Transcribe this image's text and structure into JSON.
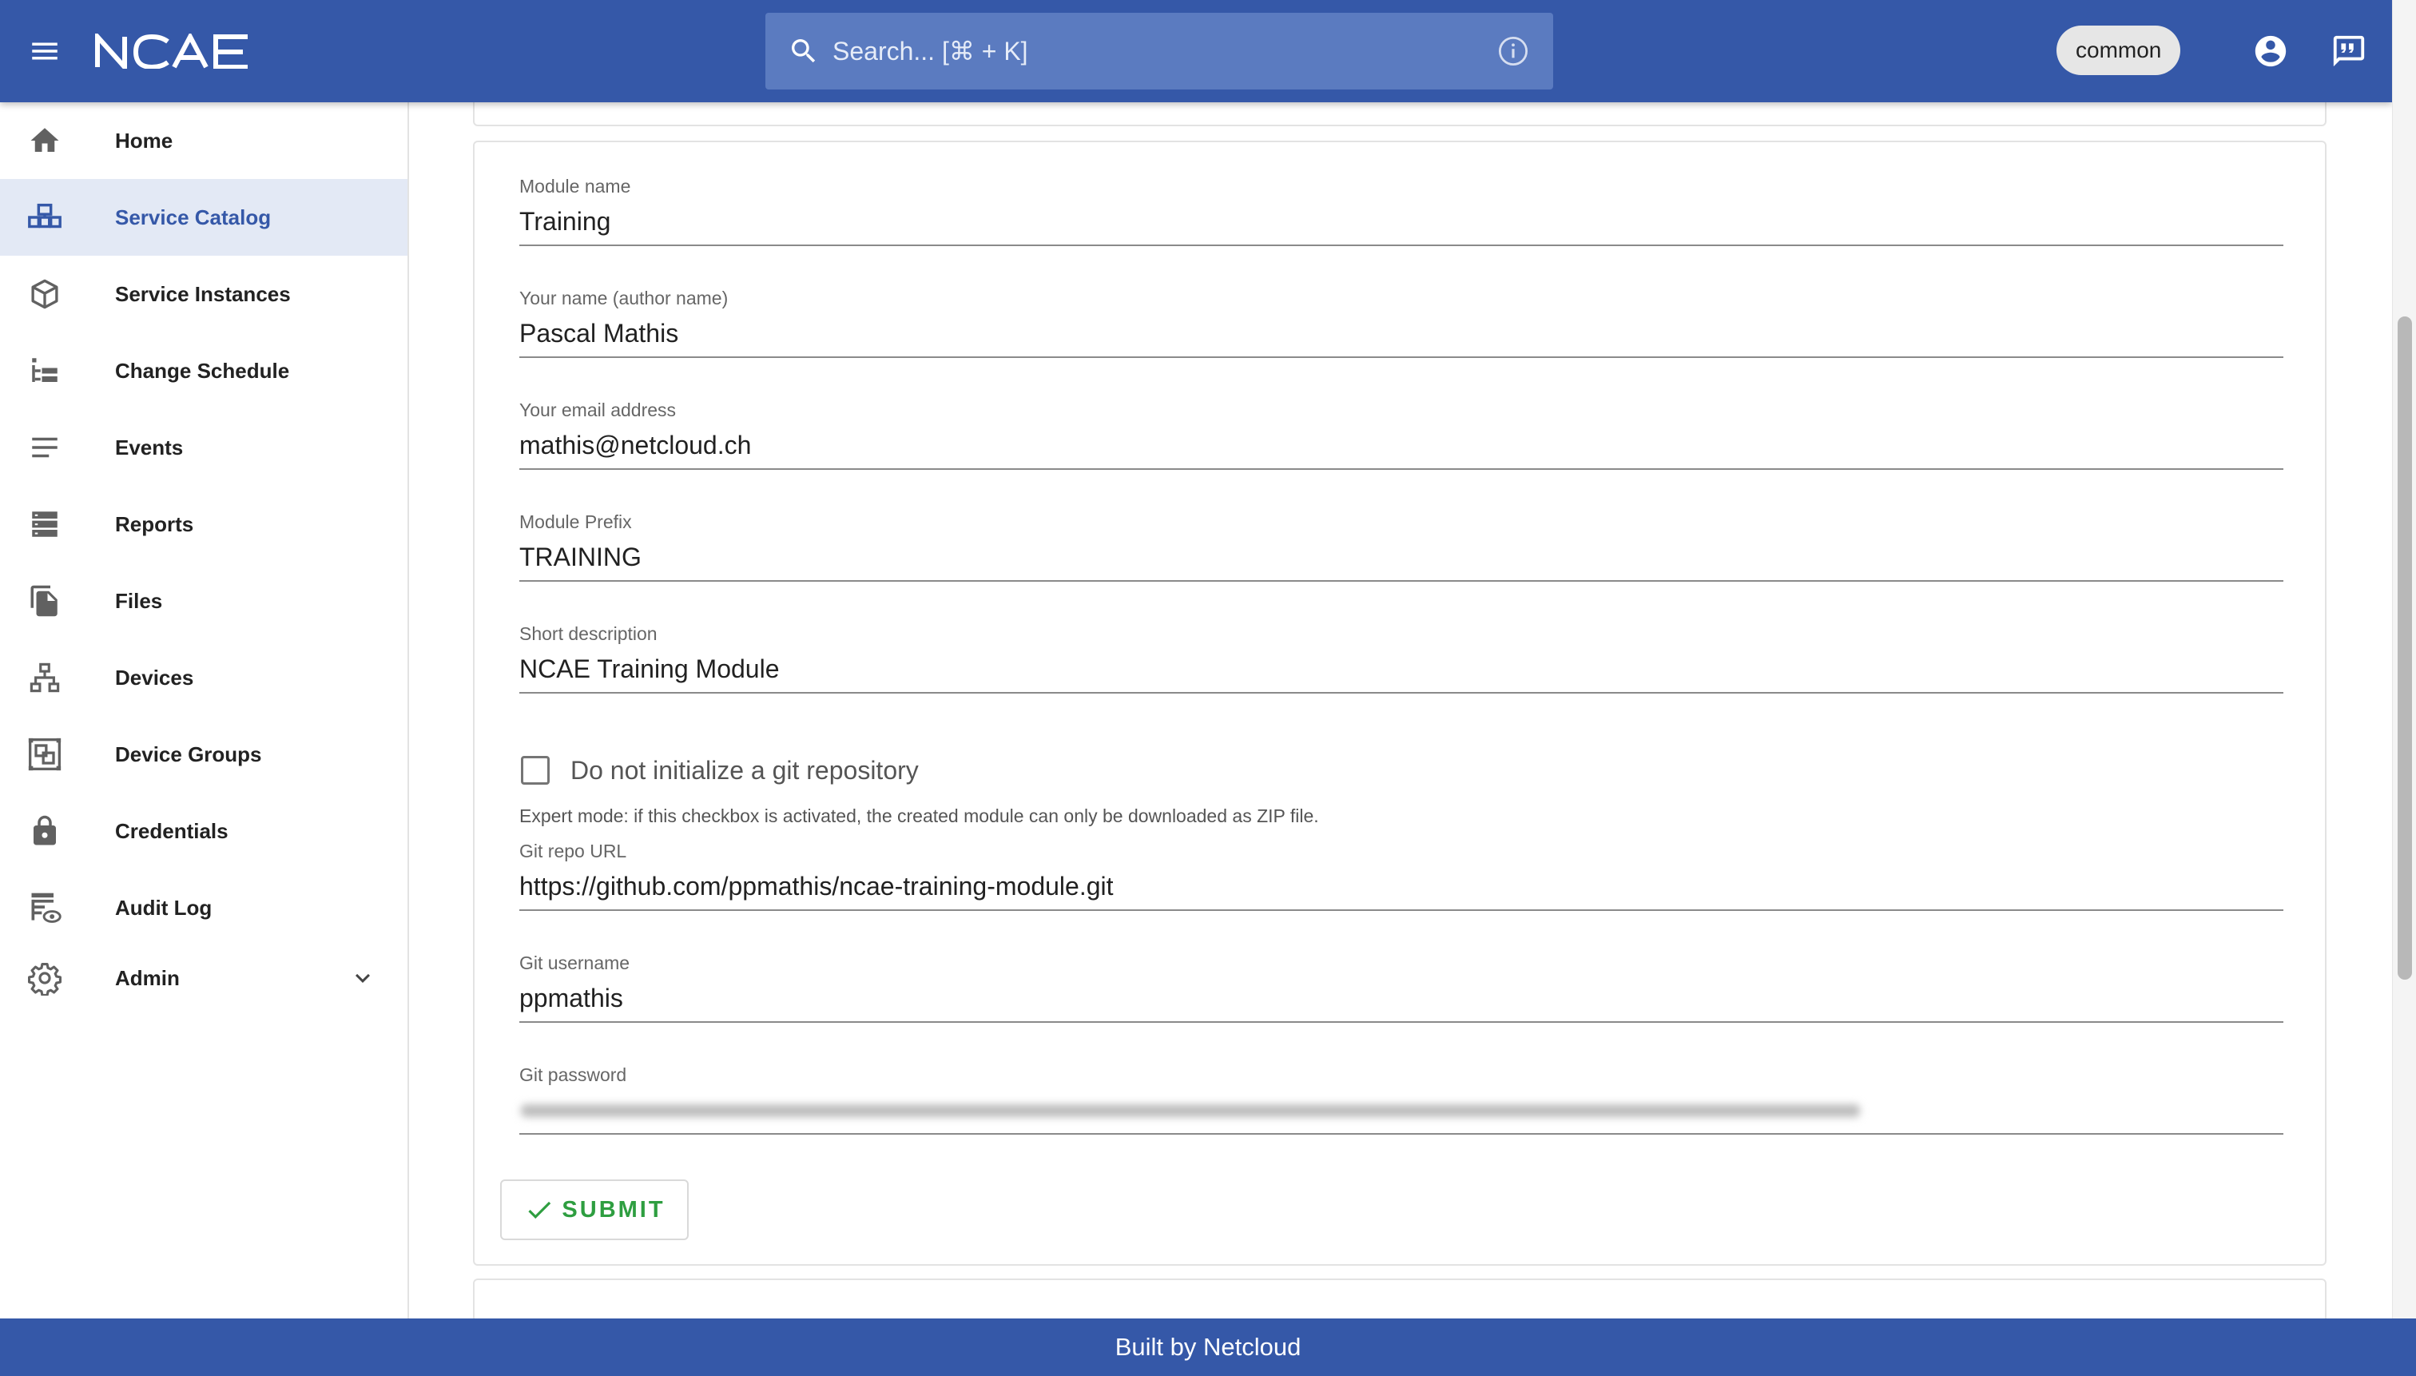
{
  "header": {
    "logo_text": "NCAE",
    "search_placeholder": "Search... [⌘ + K]",
    "namespace_chip": "common"
  },
  "sidebar": {
    "items": [
      {
        "label": "Home",
        "icon": "home-icon"
      },
      {
        "label": "Service Catalog",
        "icon": "service-catalog-icon",
        "active": true
      },
      {
        "label": "Service Instances",
        "icon": "cube-icon"
      },
      {
        "label": "Change Schedule",
        "icon": "schedule-tree-icon"
      },
      {
        "label": "Events",
        "icon": "events-lines-icon"
      },
      {
        "label": "Reports",
        "icon": "reports-icon"
      },
      {
        "label": "Files",
        "icon": "files-icon"
      },
      {
        "label": "Devices",
        "icon": "network-icon"
      },
      {
        "label": "Device Groups",
        "icon": "device-groups-icon"
      },
      {
        "label": "Credentials",
        "icon": "lock-icon"
      },
      {
        "label": "Audit Log",
        "icon": "audit-log-icon"
      },
      {
        "label": "Admin",
        "icon": "gear-icon",
        "expandable": true
      }
    ]
  },
  "form": {
    "module_name": {
      "label": "Module name",
      "value": "Training"
    },
    "author_name": {
      "label": "Your name (author name)",
      "value": "Pascal Mathis"
    },
    "email": {
      "label": "Your email address",
      "value": "mathis@netcloud.ch"
    },
    "module_prefix": {
      "label": "Module Prefix",
      "value": "TRAINING"
    },
    "short_description": {
      "label": "Short description",
      "value": "NCAE Training Module"
    },
    "no_git_checkbox": {
      "label": "Do not initialize a git repository",
      "checked": false
    },
    "expert_helper": "Expert mode: if this checkbox is activated, the created module can only be downloaded as ZIP file.",
    "git_repo_url": {
      "label": "Git repo URL",
      "value": "https://github.com/ppmathis/ncae-training-module.git"
    },
    "git_username": {
      "label": "Git username",
      "value": "ppmathis"
    },
    "git_password": {
      "label": "Git password"
    },
    "submit_label": "SUBMIT"
  },
  "footer": {
    "text": "Built by Netcloud"
  },
  "colors": {
    "primary": "#3558a8",
    "active_nav_bg": "#e3e9f5",
    "submit_green": "#2e9e40"
  }
}
